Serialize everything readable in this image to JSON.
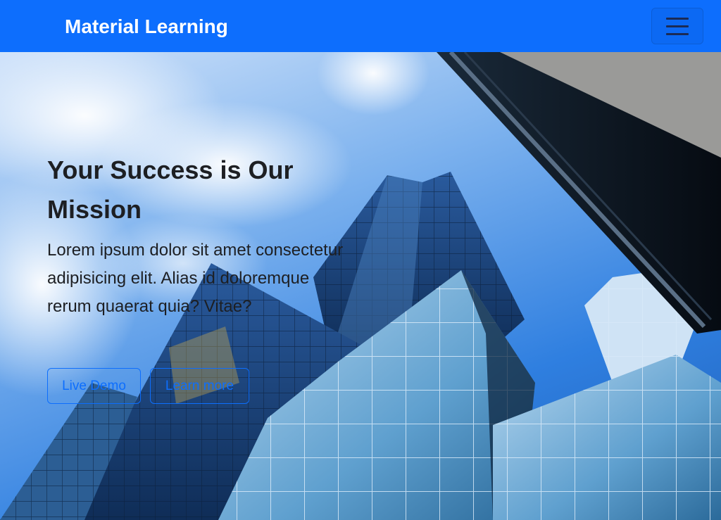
{
  "navbar": {
    "brand": "Material Learning",
    "toggler_icon": "hamburger-menu-icon",
    "color": "#0d6efd"
  },
  "hero": {
    "title": "Your Success is Our Mission",
    "text": "Lorem ipsum dolor sit amet consectetur adipisicing elit. Alias id doloremque rerum quaerat quia? Vitae?",
    "buttons": {
      "live_demo": "Live Demo",
      "learn_more": "Learn more"
    },
    "background": "skyscrapers-photo"
  }
}
